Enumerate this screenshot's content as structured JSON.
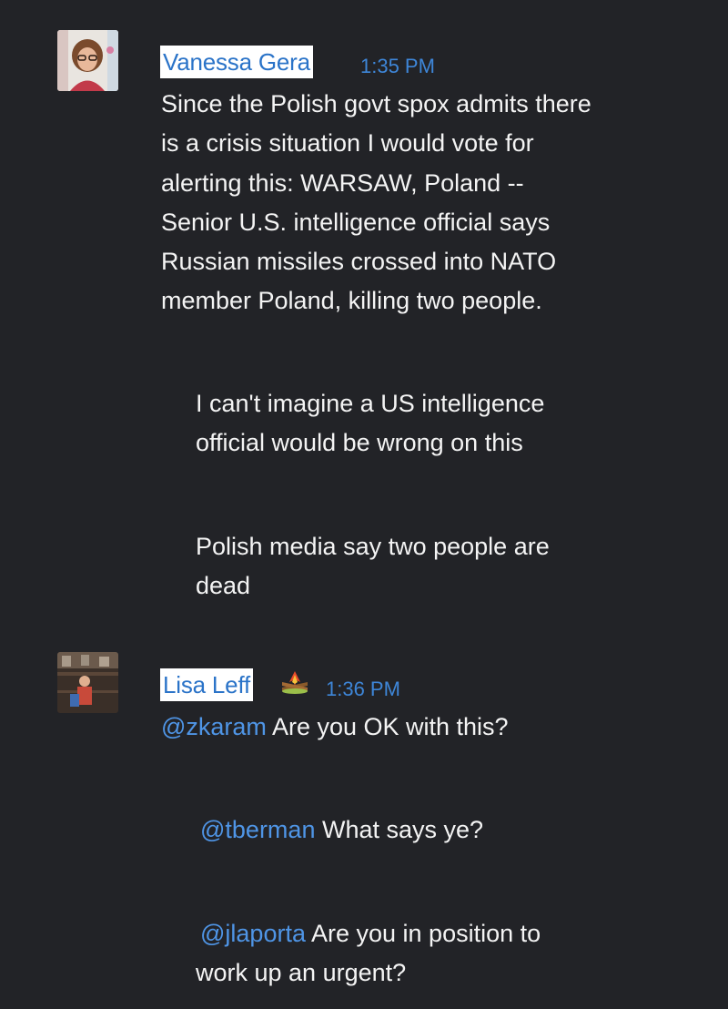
{
  "messages": [
    {
      "author": "Vanessa Gera",
      "time": "1:35 PM",
      "lines": [
        "Since the Polish govt spox admits there",
        "is a crisis situation I would vote for",
        "alerting this: WARSAW, Poland --",
        "Senior U.S. intelligence official says",
        "Russian missiles crossed into NATO",
        "member Poland, killing two people."
      ],
      "followups": [
        {
          "lines": [
            "I can't imagine a US intelligence",
            "official would be wrong on this"
          ]
        },
        {
          "lines": [
            "Polish media say two people are",
            "dead"
          ]
        }
      ]
    },
    {
      "author": "Lisa Leff",
      "author_emoji": "campfire-emoji",
      "time": "1:36 PM",
      "mention": "@zkaram",
      "text": "Are you OK with this?",
      "followups": [
        {
          "mention": "@tberman",
          "lines": [
            "What says ye?"
          ]
        },
        {
          "mention": "@jlaporta",
          "lines": [
            "Are you in position to",
            "work up an urgent?"
          ]
        }
      ]
    }
  ],
  "colors": {
    "background": "#222327",
    "name_text": "#2a73c8",
    "name_highlight": "#ffffff",
    "mention": "#4f95e6",
    "timestamp": "#3e86d8"
  }
}
